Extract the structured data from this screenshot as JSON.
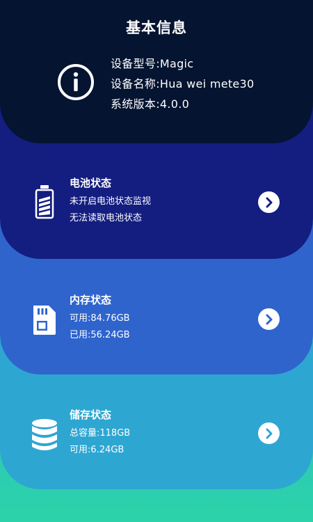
{
  "header": {
    "title": "基本信息",
    "lines": [
      "设备型号:Magic",
      "设备名称:Hua wei mete30",
      "系统版本:4.0.0"
    ]
  },
  "battery": {
    "title": "电池状态",
    "lines": [
      "未开启电池状态监视",
      "无法读取电池状态"
    ]
  },
  "memory": {
    "title": "内存状态",
    "lines": [
      "可用:84.76GB",
      "已用:56.24GB"
    ]
  },
  "storage": {
    "title": "储存状态",
    "lines": [
      "总容量:118GB",
      "可用:6.24GB"
    ]
  },
  "icons": {
    "header": "info-icon",
    "battery": "battery-icon",
    "memory": "sd-card-icon",
    "storage": "database-icon",
    "chevron": "chevron-right-icon"
  },
  "colors": {
    "header_bg": "#051430",
    "battery_bg": "#141e80",
    "memory_bg": "#2f64cd",
    "storage_bg": "#2ea6d2"
  }
}
